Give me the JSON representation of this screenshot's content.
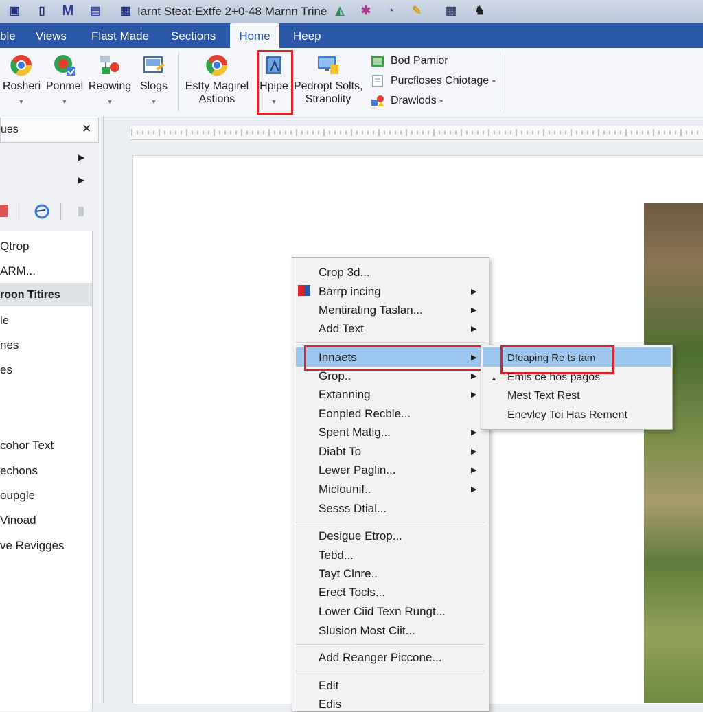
{
  "window": {
    "title": "Iarnt Steat-Extfe 2+0-48 Marnn Trine"
  },
  "tabs": [
    {
      "label": "ble"
    },
    {
      "label": "Views"
    },
    {
      "label": "Flast Made"
    },
    {
      "label": "Sections"
    },
    {
      "label": "Home",
      "active": true
    },
    {
      "label": "Heep"
    }
  ],
  "ribbon": {
    "buttons": [
      {
        "label": "Rosheri",
        "icon": "chrome-icon"
      },
      {
        "label": "Ponmel",
        "icon": "globe-icon"
      },
      {
        "label": "Reowing",
        "icon": "network-icon"
      },
      {
        "label": "Slogs",
        "icon": "image-edit-icon"
      },
      {
        "label_line1": "Estty Magirel",
        "label_line2": "Astions",
        "icon": "chrome-icon"
      },
      {
        "label": "Hpipe",
        "icon": "book-icon",
        "highlighted": true
      },
      {
        "label_line1": "Pedropt Solts,",
        "label_line2": "Stranolity",
        "icon": "monitor-icon"
      }
    ],
    "small_items": [
      {
        "label": "Bod Pamior",
        "icon": "table-icon"
      },
      {
        "label": "Purcfloses Chiotage -",
        "icon": "page-icon"
      },
      {
        "label": "Drawlods -",
        "icon": "shapes-icon"
      }
    ]
  },
  "pane": {
    "title": "ues",
    "close": "✕",
    "items": [
      "Qtrop",
      "ARM...",
      "roon Titires",
      "le",
      "nes",
      "es",
      "cohor Text",
      "echons",
      "oupgle",
      "Vinoad",
      "ve Revigges"
    ]
  },
  "context_menu": {
    "group1": [
      "Crop 3d...",
      "Barrp incing",
      "Mentirating Taslan...",
      "Add Text"
    ],
    "group2": [
      "Innaets",
      "Grop..",
      "Extanning",
      "Eonpled Recble...",
      "Spent Matig...",
      "Diabt To",
      "Lewer Paglin...",
      "Miclounif..",
      "Sesss Dtial..."
    ],
    "group3": [
      "Desigue Etrop...",
      "Tebd...",
      "Tayt Clnre..",
      "Erect Tocls...",
      "Lower Ciid Texn Rungt...",
      "Slusion Most Ciit..."
    ],
    "group4": [
      "Add Reanger Piccone..."
    ],
    "group5": [
      "Edit",
      "Edis"
    ]
  },
  "submenu": [
    "Dfeaping Re ts tam",
    "Emis ce hos pagos",
    "Mest Text Rest",
    "Enevley Toi Has Rement"
  ],
  "colors": {
    "tabbar": "#2a57a8",
    "highlight_outline": "#d9252b",
    "menu_hover": "#9dc6ef"
  }
}
